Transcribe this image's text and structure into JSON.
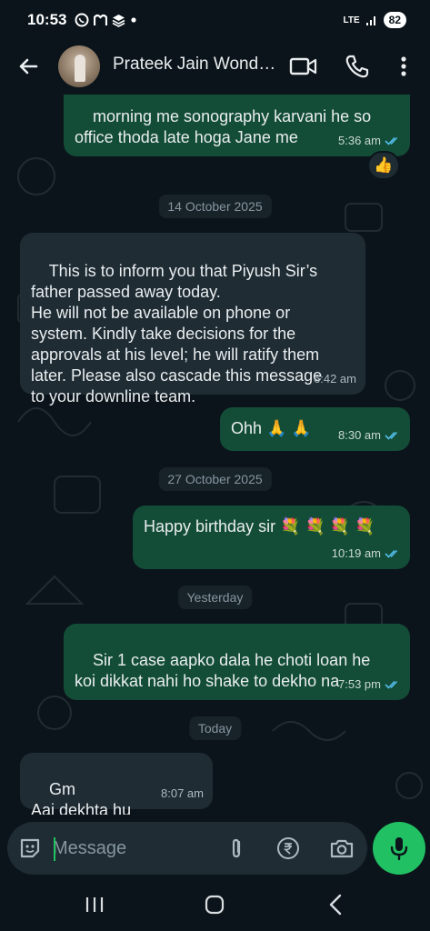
{
  "status_bar": {
    "time": "10:53",
    "left_icons": [
      "whatsapp-icon",
      "m-icon",
      "stack-icon",
      "dot-icon"
    ],
    "network": "LTE",
    "battery": "82"
  },
  "header": {
    "contact_name": "Prateek Jain Wonder Cement",
    "icons": [
      "back-arrow-icon",
      "video-call-icon",
      "phone-icon",
      "more-vertical-icon"
    ]
  },
  "messages": [
    {
      "direction": "out",
      "text": "morning me sonography karvani he so\noffice thoda late hoga Jane me",
      "time": "5:36 am",
      "read": true,
      "reaction": "👍"
    },
    {
      "type": "date",
      "text": "14 October 2025"
    },
    {
      "direction": "in",
      "text": "This is to inform you that Piyush Sir’s\nfather passed away today.\nHe will not be available on phone or\nsystem. Kindly take decisions for the\napprovals at his level; he will ratify them\nlater. Please also cascade this message\nto your downline team.",
      "time": "6:42 am"
    },
    {
      "direction": "out",
      "text": "Ohh 🙏 🙏",
      "time": "8:30 am",
      "read": true
    },
    {
      "type": "date",
      "text": "27 October 2025"
    },
    {
      "direction": "out",
      "text": "Happy birthday sir 💐 💐 💐 💐",
      "time": "10:19 am",
      "read": true
    },
    {
      "type": "date",
      "text": "Yesterday"
    },
    {
      "direction": "out",
      "text": "Sir 1 case aapko dala he choti loan he\nkoi dikkat nahi ho shake to dekho na",
      "time": "7:53 pm",
      "read": true
    },
    {
      "type": "date",
      "text": "Today"
    },
    {
      "direction": "in",
      "text": "Gm\nAaj dekhta hu",
      "time": "8:07 am"
    }
  ],
  "input": {
    "placeholder": "Message",
    "icons": [
      "emoji-icon",
      "paperclip-icon",
      "rupee-icon",
      "camera-icon",
      "mic-icon"
    ]
  },
  "nav_bar": {
    "icons": [
      "recents-icon",
      "home-icon",
      "back-icon"
    ]
  },
  "colors": {
    "background": "#0b141a",
    "outgoing_bubble": "#134d37",
    "incoming_bubble": "#1f2c34",
    "accent": "#21c063",
    "read_ticks": "#53bdeb"
  }
}
